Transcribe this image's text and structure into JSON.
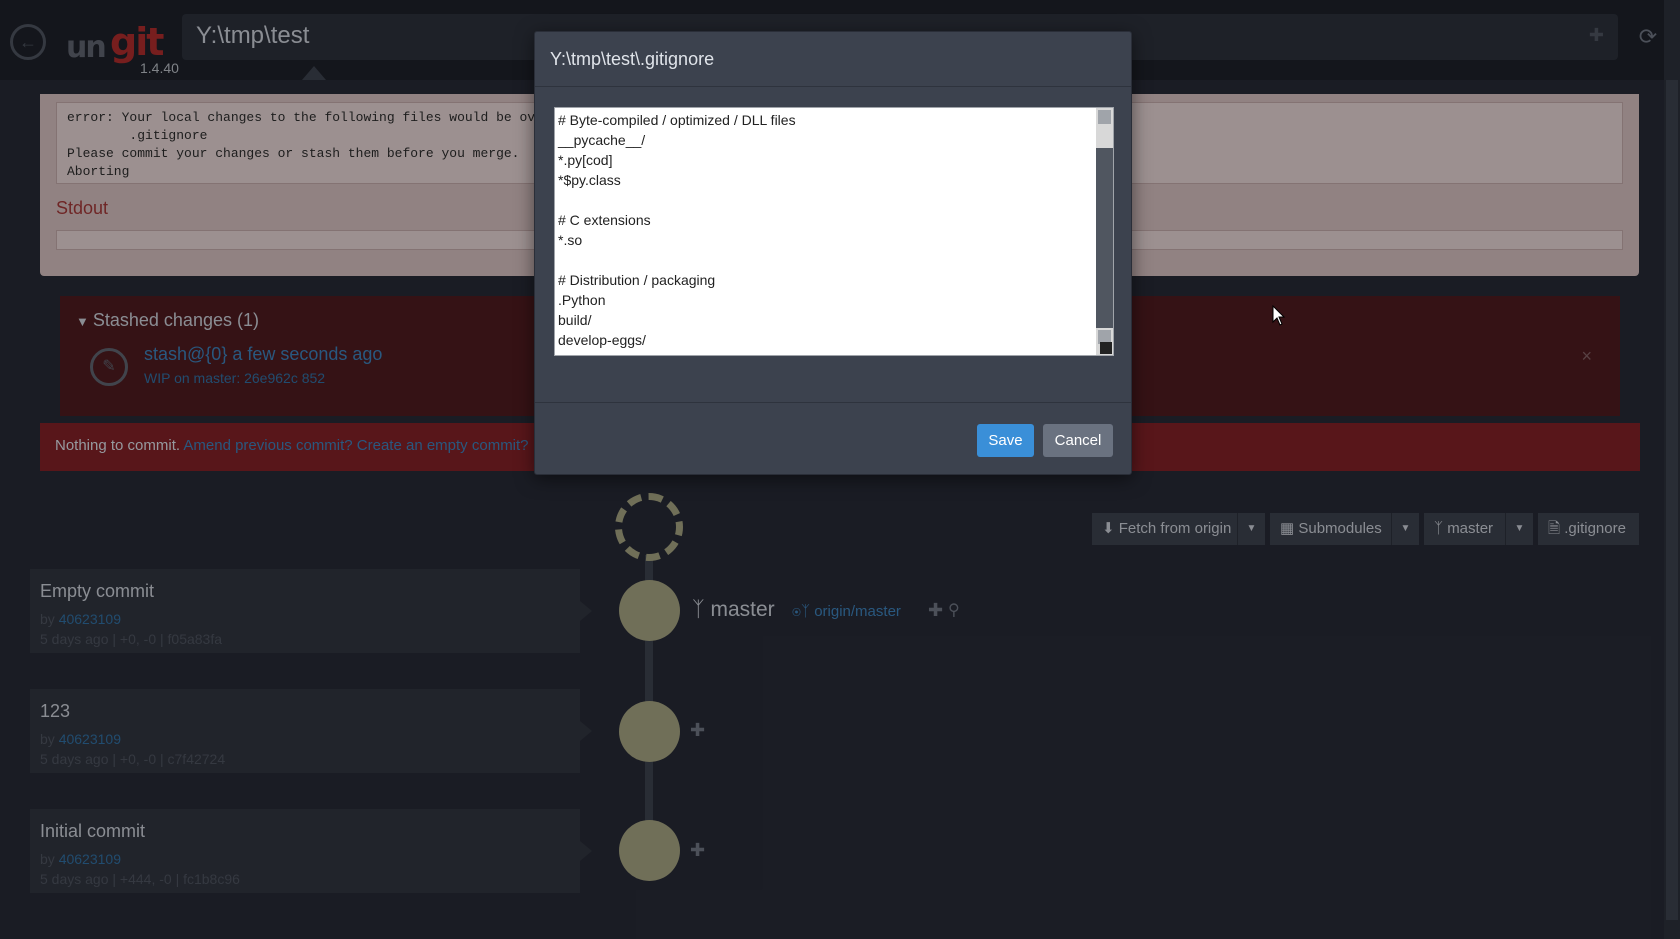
{
  "header": {
    "back_icon": "back-arrow-icon",
    "logo_part1": "un",
    "logo_part2": "git",
    "version": "1.4.40",
    "path_value": "Y:\\tmp\\test",
    "refresh_icon": "refresh-icon"
  },
  "error_panel": {
    "output": "error: Your local changes to the following files would be ov\n        .gitignore\nPlease commit your changes or stash them before you merge.\nAborting",
    "stdout_label": "Stdout"
  },
  "stash": {
    "title": "Stashed changes (1)",
    "item_name": "stash@{0} a few seconds ago",
    "item_sub": "WIP on master: 26e962c 852",
    "close_label": "×"
  },
  "nothing_bar": {
    "text": "Nothing to commit.",
    "amend_link": "Amend previous commit?",
    "empty_link": "Create an empty commit?"
  },
  "toolbar": {
    "fetch_label": "Fetch from origin",
    "submodules_label": "Submodules",
    "branch_label": "master",
    "gitignore_label": ".gitignore"
  },
  "graph": {
    "ref_master": "master",
    "ref_origin": "origin/master"
  },
  "commits": [
    {
      "title": "Empty commit",
      "by": "by",
      "author": "40623109",
      "meta": "5 days ago | +0, -0 | f05a83fa"
    },
    {
      "title": "123",
      "by": "by",
      "author": "40623109",
      "meta": "5 days ago | +0, -0 | c7f42724"
    },
    {
      "title": "Initial commit",
      "by": "by",
      "author": "40623109",
      "meta": "5 days ago | +444, -0 | fc1b8c96"
    }
  ],
  "modal": {
    "title": "Y:\\tmp\\test\\.gitignore",
    "content": "# Byte-compiled / optimized / DLL files\n__pycache__/\n*.py[cod]\n*$py.class\n\n# C extensions\n*.so\n\n# Distribution / packaging\n.Python\nbuild/\ndevelop-eggs/\ndist/",
    "save_label": "Save",
    "cancel_label": "Cancel"
  },
  "colors": {
    "background": "#252833",
    "error_panel": "#c9b4b4",
    "stash_panel": "#4a1a1e",
    "nothing_bar": "#7a1f24",
    "node": "#9c9a7a",
    "save_button": "#3a8fd8",
    "link": "#3a7ab0"
  }
}
